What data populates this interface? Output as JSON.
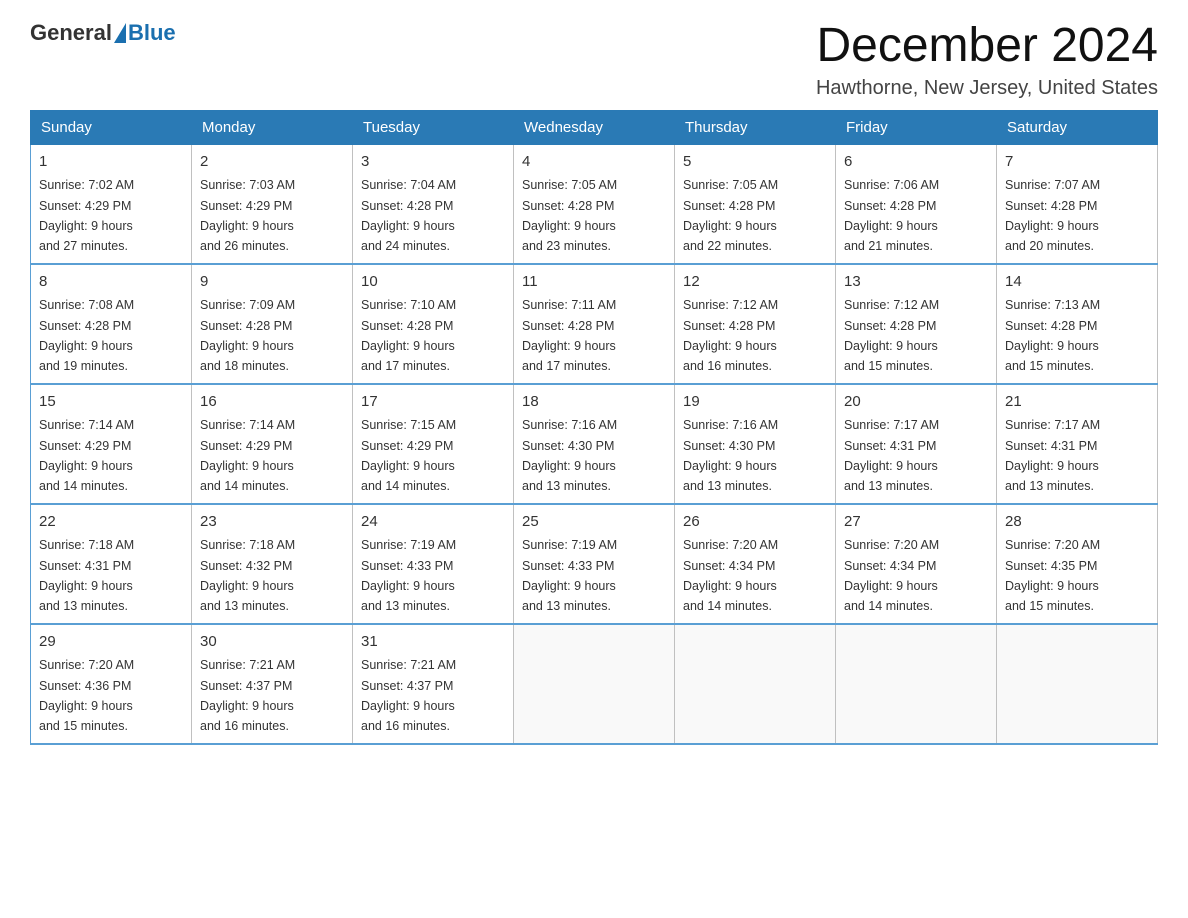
{
  "header": {
    "logo_general": "General",
    "logo_blue": "Blue",
    "month_title": "December 2024",
    "location": "Hawthorne, New Jersey, United States"
  },
  "weekdays": [
    "Sunday",
    "Monday",
    "Tuesday",
    "Wednesday",
    "Thursday",
    "Friday",
    "Saturday"
  ],
  "weeks": [
    [
      {
        "day": "1",
        "sunrise": "7:02 AM",
        "sunset": "4:29 PM",
        "daylight": "9 hours and 27 minutes."
      },
      {
        "day": "2",
        "sunrise": "7:03 AM",
        "sunset": "4:29 PM",
        "daylight": "9 hours and 26 minutes."
      },
      {
        "day": "3",
        "sunrise": "7:04 AM",
        "sunset": "4:28 PM",
        "daylight": "9 hours and 24 minutes."
      },
      {
        "day": "4",
        "sunrise": "7:05 AM",
        "sunset": "4:28 PM",
        "daylight": "9 hours and 23 minutes."
      },
      {
        "day": "5",
        "sunrise": "7:05 AM",
        "sunset": "4:28 PM",
        "daylight": "9 hours and 22 minutes."
      },
      {
        "day": "6",
        "sunrise": "7:06 AM",
        "sunset": "4:28 PM",
        "daylight": "9 hours and 21 minutes."
      },
      {
        "day": "7",
        "sunrise": "7:07 AM",
        "sunset": "4:28 PM",
        "daylight": "9 hours and 20 minutes."
      }
    ],
    [
      {
        "day": "8",
        "sunrise": "7:08 AM",
        "sunset": "4:28 PM",
        "daylight": "9 hours and 19 minutes."
      },
      {
        "day": "9",
        "sunrise": "7:09 AM",
        "sunset": "4:28 PM",
        "daylight": "9 hours and 18 minutes."
      },
      {
        "day": "10",
        "sunrise": "7:10 AM",
        "sunset": "4:28 PM",
        "daylight": "9 hours and 17 minutes."
      },
      {
        "day": "11",
        "sunrise": "7:11 AM",
        "sunset": "4:28 PM",
        "daylight": "9 hours and 17 minutes."
      },
      {
        "day": "12",
        "sunrise": "7:12 AM",
        "sunset": "4:28 PM",
        "daylight": "9 hours and 16 minutes."
      },
      {
        "day": "13",
        "sunrise": "7:12 AM",
        "sunset": "4:28 PM",
        "daylight": "9 hours and 15 minutes."
      },
      {
        "day": "14",
        "sunrise": "7:13 AM",
        "sunset": "4:28 PM",
        "daylight": "9 hours and 15 minutes."
      }
    ],
    [
      {
        "day": "15",
        "sunrise": "7:14 AM",
        "sunset": "4:29 PM",
        "daylight": "9 hours and 14 minutes."
      },
      {
        "day": "16",
        "sunrise": "7:14 AM",
        "sunset": "4:29 PM",
        "daylight": "9 hours and 14 minutes."
      },
      {
        "day": "17",
        "sunrise": "7:15 AM",
        "sunset": "4:29 PM",
        "daylight": "9 hours and 14 minutes."
      },
      {
        "day": "18",
        "sunrise": "7:16 AM",
        "sunset": "4:30 PM",
        "daylight": "9 hours and 13 minutes."
      },
      {
        "day": "19",
        "sunrise": "7:16 AM",
        "sunset": "4:30 PM",
        "daylight": "9 hours and 13 minutes."
      },
      {
        "day": "20",
        "sunrise": "7:17 AM",
        "sunset": "4:31 PM",
        "daylight": "9 hours and 13 minutes."
      },
      {
        "day": "21",
        "sunrise": "7:17 AM",
        "sunset": "4:31 PM",
        "daylight": "9 hours and 13 minutes."
      }
    ],
    [
      {
        "day": "22",
        "sunrise": "7:18 AM",
        "sunset": "4:31 PM",
        "daylight": "9 hours and 13 minutes."
      },
      {
        "day": "23",
        "sunrise": "7:18 AM",
        "sunset": "4:32 PM",
        "daylight": "9 hours and 13 minutes."
      },
      {
        "day": "24",
        "sunrise": "7:19 AM",
        "sunset": "4:33 PM",
        "daylight": "9 hours and 13 minutes."
      },
      {
        "day": "25",
        "sunrise": "7:19 AM",
        "sunset": "4:33 PM",
        "daylight": "9 hours and 13 minutes."
      },
      {
        "day": "26",
        "sunrise": "7:20 AM",
        "sunset": "4:34 PM",
        "daylight": "9 hours and 14 minutes."
      },
      {
        "day": "27",
        "sunrise": "7:20 AM",
        "sunset": "4:34 PM",
        "daylight": "9 hours and 14 minutes."
      },
      {
        "day": "28",
        "sunrise": "7:20 AM",
        "sunset": "4:35 PM",
        "daylight": "9 hours and 15 minutes."
      }
    ],
    [
      {
        "day": "29",
        "sunrise": "7:20 AM",
        "sunset": "4:36 PM",
        "daylight": "9 hours and 15 minutes."
      },
      {
        "day": "30",
        "sunrise": "7:21 AM",
        "sunset": "4:37 PM",
        "daylight": "9 hours and 16 minutes."
      },
      {
        "day": "31",
        "sunrise": "7:21 AM",
        "sunset": "4:37 PM",
        "daylight": "9 hours and 16 minutes."
      },
      null,
      null,
      null,
      null
    ]
  ],
  "labels": {
    "sunrise": "Sunrise:",
    "sunset": "Sunset:",
    "daylight": "Daylight:"
  }
}
